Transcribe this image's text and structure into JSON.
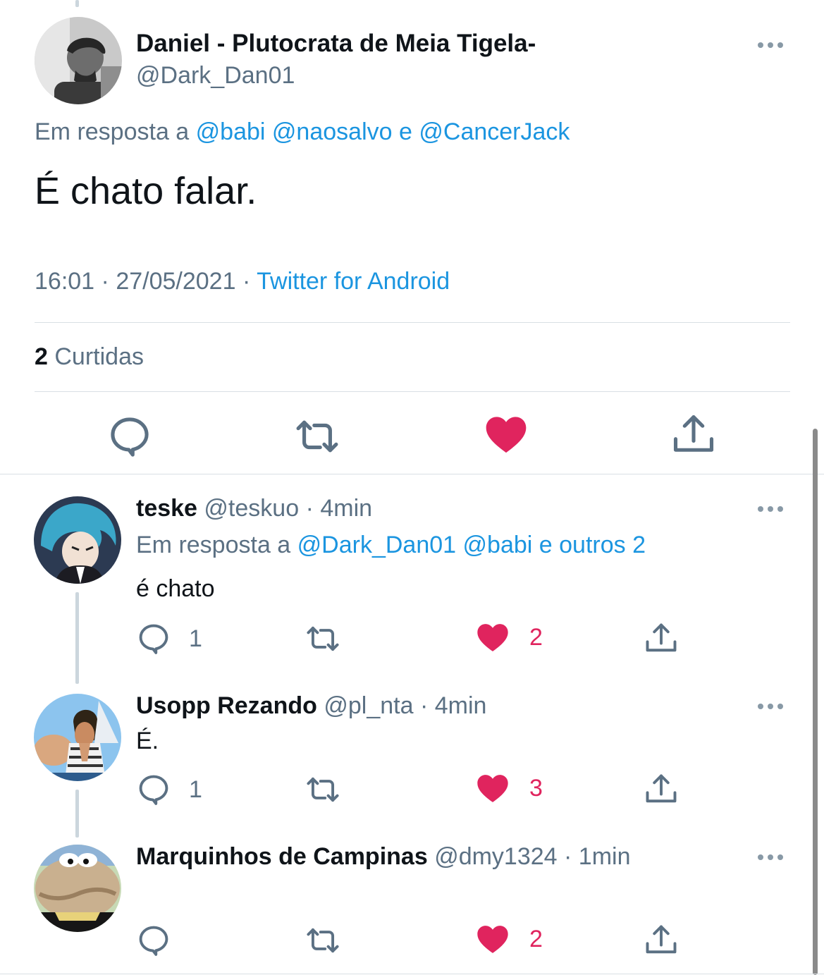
{
  "main_tweet": {
    "display_name": "Daniel - Plutocrata de Meia Tigela-",
    "handle": "@Dark_Dan01",
    "reply_prefix": "Em resposta a",
    "reply_user1": "@babi",
    "reply_user2": "@naosalvo",
    "reply_conj": "e",
    "reply_user3": "@CancerJack",
    "text": "É chato falar.",
    "time": "16:01",
    "date": "27/05/2021",
    "sep": "·",
    "source": "Twitter for Android",
    "likes_count": "2",
    "likes_label": "Curtidas"
  },
  "replies": [
    {
      "display_name": "teske",
      "handle": "@teskuo",
      "time": "· 4min",
      "reply_prefix": "Em resposta a",
      "reply_user1": "@Dark_Dan01",
      "reply_user2": "@babi",
      "reply_rest": "e outros 2",
      "text": "é chato",
      "reply_count": "1",
      "retweet_count": "",
      "like_count": "2"
    },
    {
      "display_name": "Usopp Rezando",
      "handle": "@pl_nta",
      "time": "· 4min",
      "text": "É.",
      "reply_count": "1",
      "retweet_count": "",
      "like_count": "3"
    },
    {
      "display_name": "Marquinhos de Campinas",
      "handle": "@dmy1324",
      "time": "· 1min",
      "text": "",
      "reply_count": "",
      "retweet_count": "",
      "like_count": "2"
    }
  ],
  "colors": {
    "link_blue": "#1b95e0",
    "like_pink": "#e0245e",
    "secondary_gray": "#5b7083",
    "icon_gray": "#5b7083"
  },
  "icons": [
    "reply-icon",
    "retweet-icon",
    "like-icon",
    "share-icon",
    "more-icon"
  ]
}
